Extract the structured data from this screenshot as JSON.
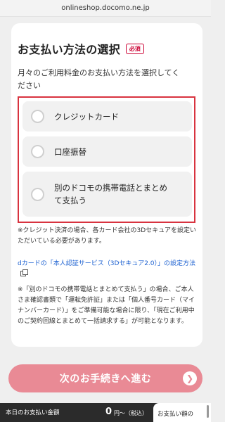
{
  "browser": {
    "url": "onlineshop.docomo.ne.jp"
  },
  "section": {
    "title": "お支払い方法の選択",
    "required_badge": "必須",
    "instruction": "月々のご利用料金のお支払い方法を選択してください"
  },
  "options": [
    {
      "label": "クレジットカード"
    },
    {
      "label": "口座振替"
    },
    {
      "label": "別のドコモの携帯電話とまとめて支払う"
    }
  ],
  "notes": {
    "credit_note": "※クレジット決済の場合、各カード会社の3Dセキュアを設定いただいている必要があります。",
    "auth_link": "dカードの「本人認証サービス（3Dセキュア2.0）」の設定方法",
    "bundle_note": "※「別のドコモの携帯電話とまとめて支払う」の場合、ご本人さま確認書類で「運転免許証」または「個人番号カード（マイナンバーカード）」をご準備可能な場合に限り、「現在ご利用中のご契約回線とまとめて一括請求する」が可能となります。"
  },
  "next_button": {
    "label": "次のお手続きへ進む",
    "icon": "chevron-right-icon"
  },
  "footer": {
    "label": "本日のお支払い金額",
    "amount": "0",
    "unit": "円〜（税込）",
    "tab_label": "お支払い額の"
  }
}
